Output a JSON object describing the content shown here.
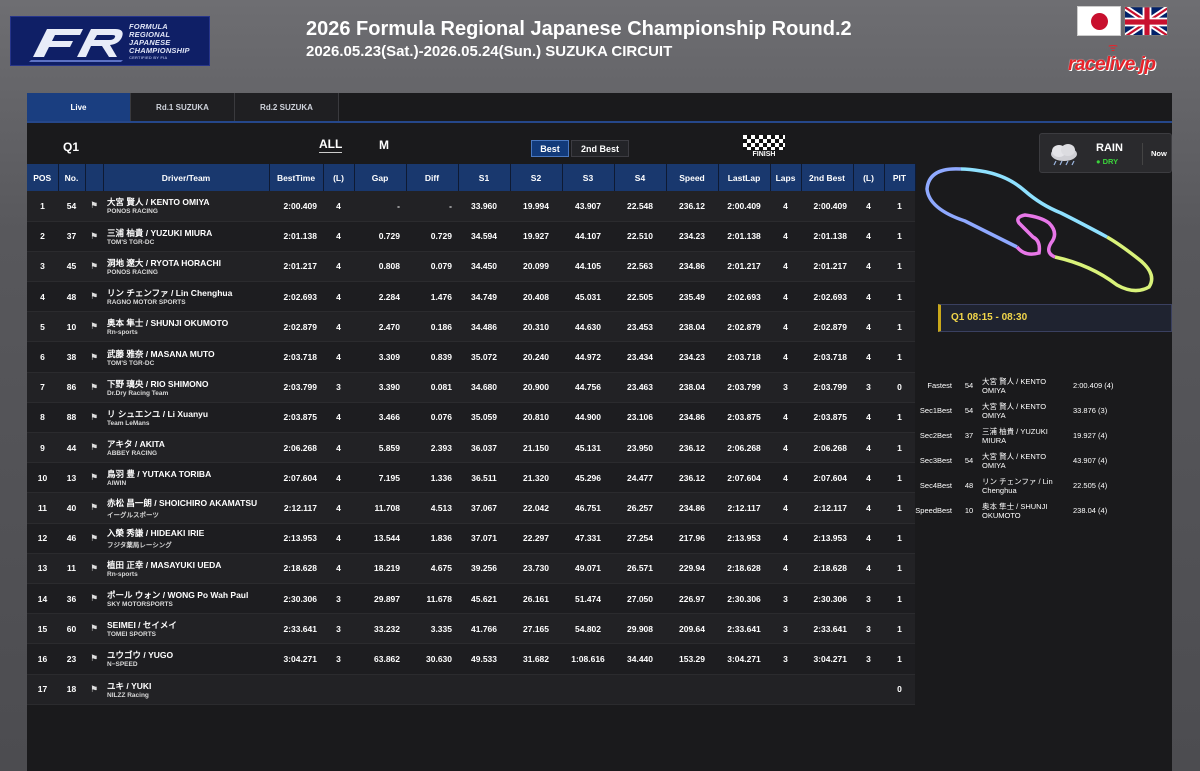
{
  "header": {
    "logo_text": [
      "FORMULA",
      "REGIONAL",
      "JAPANESE",
      "CHAMPIONSHIP"
    ],
    "logo_sub": "CERTIFIED BY FIA",
    "title": "2026 Formula Regional Japanese Championship Round.2",
    "subtitle": "2026.05.23(Sat.)-2026.05.24(Sun.) SUZUKA CIRCUIT",
    "brand": "racelive.jp"
  },
  "tabs": [
    "Live",
    "Rd.1 SUZUKA",
    "Rd.2 SUZUKA"
  ],
  "controls": {
    "session": "Q1",
    "all": "ALL",
    "m": "M",
    "best": "Best",
    "best2": "2nd Best",
    "finish": "FINISH"
  },
  "columns": [
    "POS",
    "No.",
    "",
    "Driver/Team",
    "BestTime",
    "(L)",
    "Gap",
    "Diff",
    "S1",
    "S2",
    "S3",
    "S4",
    "Speed",
    "LastLap",
    "Laps",
    "2nd Best",
    "(L)",
    "PIT"
  ],
  "rows": [
    {
      "pos": "1",
      "no": "54",
      "driver": "大宮 賢人 / KENTO OMIYA",
      "team": "PONOS RACING",
      "best": "2:00.409",
      "l": "4",
      "gap": "-",
      "diff": "-",
      "s1": "33.960",
      "s2": "19.994",
      "s3": "43.907",
      "s4": "22.548",
      "speed": "236.12",
      "last": "2:00.409",
      "laps": "4",
      "best2": "2:00.409",
      "l2": "4",
      "pit": "1",
      "c": [
        "w",
        "g",
        "r",
        "g",
        "g",
        "r"
      ]
    },
    {
      "pos": "2",
      "no": "37",
      "driver": "三浦 柚貴 / YUZUKI MIURA",
      "team": "TOM'S TGR-DC",
      "best": "2:01.138",
      "l": "4",
      "gap": "0.729",
      "diff": "0.729",
      "s1": "34.594",
      "s2": "19.927",
      "s3": "44.107",
      "s4": "22.510",
      "speed": "234.23",
      "last": "2:01.138",
      "laps": "4",
      "best2": "2:01.138",
      "l2": "4",
      "pit": "1",
      "c": [
        "g",
        "r",
        "g",
        "g",
        "g",
        "g"
      ]
    },
    {
      "pos": "3",
      "no": "45",
      "driver": "洞地 遼大 / RYOTA HORACHI",
      "team": "PONOS RACING",
      "best": "2:01.217",
      "l": "4",
      "gap": "0.808",
      "diff": "0.079",
      "s1": "34.450",
      "s2": "20.099",
      "s3": "44.105",
      "s4": "22.563",
      "speed": "234.86",
      "last": "2:01.217",
      "laps": "4",
      "best2": "2:01.217",
      "l2": "4",
      "pit": "1",
      "c": [
        "g",
        "g",
        "g",
        "g",
        "w",
        "g"
      ]
    },
    {
      "pos": "4",
      "no": "48",
      "driver": "リン チェンファ / Lin Chenghua",
      "team": "RAGNO MOTOR SPORTS",
      "best": "2:02.693",
      "l": "4",
      "gap": "2.284",
      "diff": "1.476",
      "s1": "34.749",
      "s2": "20.408",
      "s3": "45.031",
      "s4": "22.505",
      "speed": "235.49",
      "last": "2:02.693",
      "laps": "4",
      "best2": "2:02.693",
      "l2": "4",
      "pit": "1",
      "c": [
        "g",
        "g",
        "g",
        "r",
        "g",
        "g"
      ]
    },
    {
      "pos": "5",
      "no": "10",
      "driver": "奥本 隼士 / SHUNJI OKUMOTO",
      "team": "Rn-sports",
      "best": "2:02.879",
      "l": "4",
      "gap": "2.470",
      "diff": "0.186",
      "s1": "34.486",
      "s2": "20.310",
      "s3": "44.630",
      "s4": "23.453",
      "speed": "238.04",
      "last": "2:02.879",
      "laps": "4",
      "best2": "2:02.879",
      "l2": "4",
      "pit": "1",
      "c": [
        "w",
        "g",
        "g",
        "g",
        "r",
        "g"
      ]
    },
    {
      "pos": "6",
      "no": "38",
      "driver": "武藤 雅奈 / MASANA MUTO",
      "team": "TOM'S TGR-DC",
      "best": "2:03.718",
      "l": "4",
      "gap": "3.309",
      "diff": "0.839",
      "s1": "35.072",
      "s2": "20.240",
      "s3": "44.972",
      "s4": "23.434",
      "speed": "234.23",
      "last": "2:03.718",
      "laps": "4",
      "best2": "2:03.718",
      "l2": "4",
      "pit": "1",
      "c": [
        "g",
        "g",
        "g",
        "g",
        "g",
        "g"
      ]
    },
    {
      "pos": "7",
      "no": "86",
      "driver": "下野 璃央 / RIO SHIMONO",
      "team": "Dr.Dry Racing Team",
      "best": "2:03.799",
      "l": "3",
      "gap": "3.390",
      "diff": "0.081",
      "s1": "34.680",
      "s2": "20.900",
      "s3": "44.756",
      "s4": "23.463",
      "speed": "238.04",
      "last": "2:03.799",
      "laps": "3",
      "best2": "2:03.799",
      "l2": "3",
      "pit": "0",
      "c": [
        "g",
        "w",
        "g",
        "g",
        "g",
        "g"
      ]
    },
    {
      "pos": "8",
      "no": "88",
      "driver": "リ シュエンユ / Li Xuanyu",
      "team": "Team LeMans",
      "best": "2:03.875",
      "l": "4",
      "gap": "3.466",
      "diff": "0.076",
      "s1": "35.059",
      "s2": "20.810",
      "s3": "44.900",
      "s4": "23.106",
      "speed": "234.86",
      "last": "2:03.875",
      "laps": "4",
      "best2": "2:03.875",
      "l2": "4",
      "pit": "1",
      "c": [
        "g",
        "g",
        "g",
        "g",
        "g",
        "g"
      ]
    },
    {
      "pos": "9",
      "no": "44",
      "driver": "アキタ / AKITA",
      "team": "ABBEY RACING",
      "best": "2:06.268",
      "l": "4",
      "gap": "5.859",
      "diff": "2.393",
      "s1": "36.037",
      "s2": "21.150",
      "s3": "45.131",
      "s4": "23.950",
      "speed": "236.12",
      "last": "2:06.268",
      "laps": "4",
      "best2": "2:06.268",
      "l2": "4",
      "pit": "1",
      "c": [
        "g",
        "g",
        "g",
        "g",
        "g",
        "g"
      ]
    },
    {
      "pos": "10",
      "no": "13",
      "driver": "鳥羽 豊 / YUTAKA TORIBA",
      "team": "AIWIN",
      "best": "2:07.604",
      "l": "4",
      "gap": "7.195",
      "diff": "1.336",
      "s1": "36.511",
      "s2": "21.320",
      "s3": "45.296",
      "s4": "24.477",
      "speed": "236.12",
      "last": "2:07.604",
      "laps": "4",
      "best2": "2:07.604",
      "l2": "4",
      "pit": "1",
      "c": [
        "w",
        "w",
        "g",
        "w",
        "g",
        "g"
      ]
    },
    {
      "pos": "11",
      "no": "40",
      "driver": "赤松 昌一朗 / SHOICHIRO AKAMATSU",
      "team": "イーグルスポーツ",
      "best": "2:12.117",
      "l": "4",
      "gap": "11.708",
      "diff": "4.513",
      "s1": "37.067",
      "s2": "22.042",
      "s3": "46.751",
      "s4": "26.257",
      "speed": "234.86",
      "last": "2:12.117",
      "laps": "4",
      "best2": "2:12.117",
      "l2": "4",
      "pit": "1",
      "c": [
        "g",
        "g",
        "g",
        "w",
        "w",
        "g"
      ]
    },
    {
      "pos": "12",
      "no": "46",
      "driver": "入榮 秀謙 / HIDEAKI IRIE",
      "team": "フジタ薬局レーシング",
      "best": "2:13.953",
      "l": "4",
      "gap": "13.544",
      "diff": "1.836",
      "s1": "37.071",
      "s2": "22.297",
      "s3": "47.331",
      "s4": "27.254",
      "speed": "217.96",
      "last": "2:13.953",
      "laps": "4",
      "best2": "2:13.953",
      "l2": "4",
      "pit": "1",
      "c": [
        "g",
        "g",
        "w",
        "w",
        "w",
        "g"
      ]
    },
    {
      "pos": "13",
      "no": "11",
      "driver": "植田 正幸 / MASAYUKI UEDA",
      "team": "Rn-sports",
      "best": "2:18.628",
      "l": "4",
      "gap": "18.219",
      "diff": "4.675",
      "s1": "39.256",
      "s2": "23.730",
      "s3": "49.071",
      "s4": "26.571",
      "speed": "229.94",
      "last": "2:18.628",
      "laps": "4",
      "best2": "2:18.628",
      "l2": "4",
      "pit": "1",
      "c": [
        "g",
        "g",
        "g",
        "g",
        "g",
        "g"
      ]
    },
    {
      "pos": "14",
      "no": "36",
      "driver": "ポール ウォン / WONG Po Wah Paul",
      "team": "SKY MOTORSPORTS",
      "best": "2:30.306",
      "l": "3",
      "gap": "29.897",
      "diff": "11.678",
      "s1": "45.621",
      "s2": "26.161",
      "s3": "51.474",
      "s4": "27.050",
      "speed": "226.97",
      "last": "2:30.306",
      "laps": "3",
      "best2": "2:30.306",
      "l2": "3",
      "pit": "1",
      "c": [
        "g",
        "g",
        "g",
        "g",
        "g",
        "g"
      ]
    },
    {
      "pos": "15",
      "no": "60",
      "driver": "SEIMEI / セイメイ",
      "team": "TOMEI SPORTS",
      "best": "2:33.641",
      "l": "3",
      "gap": "33.232",
      "diff": "3.335",
      "s1": "41.766",
      "s2": "27.165",
      "s3": "54.802",
      "s4": "29.908",
      "speed": "209.64",
      "last": "2:33.641",
      "laps": "3",
      "best2": "2:33.641",
      "l2": "3",
      "pit": "1",
      "c": [
        "g",
        "g",
        "g",
        "g",
        "w",
        "g"
      ]
    },
    {
      "pos": "16",
      "no": "23",
      "driver": "ユウゴウ / YUGO",
      "team": "N−SPEED",
      "best": "3:04.271",
      "l": "3",
      "gap": "63.862",
      "diff": "30.630",
      "s1": "49.533",
      "s2": "31.682",
      "s3": "1:08.616",
      "s4": "34.440",
      "speed": "153.29",
      "last": "3:04.271",
      "laps": "3",
      "best2": "3:04.271",
      "l2": "3",
      "pit": "1",
      "c": [
        "g",
        "w",
        "g",
        "g",
        "w",
        "g"
      ]
    },
    {
      "pos": "17",
      "no": "18",
      "driver": "ユキ / YUKI",
      "team": "NILZZ Racing",
      "best": "",
      "l": "",
      "gap": "",
      "diff": "",
      "s1": "",
      "s2": "",
      "s3": "",
      "s4": "",
      "speed": "",
      "last": "",
      "laps": "",
      "best2": "",
      "l2": "",
      "pit": "0",
      "c": [
        "w",
        "w",
        "w",
        "w",
        "w",
        "w"
      ]
    }
  ],
  "weather": {
    "condition": "RAIN",
    "track": "● DRY",
    "now": "Now"
  },
  "session_bar": "Q1 08:15 - 08:30",
  "bests": [
    {
      "label": "Fastest",
      "no": "54",
      "driver": "大宮 賢人 / KENTO OMIYA",
      "value": "2:00.409 (4)"
    },
    {
      "label": "Sec1Best",
      "no": "54",
      "driver": "大宮 賢人 / KENTO OMIYA",
      "value": "33.876 (3)"
    },
    {
      "label": "Sec2Best",
      "no": "37",
      "driver": "三浦 柚貴 / YUZUKI MIURA",
      "value": "19.927 (4)"
    },
    {
      "label": "Sec3Best",
      "no": "54",
      "driver": "大宮 賢人 / KENTO OMIYA",
      "value": "43.907 (4)"
    },
    {
      "label": "Sec4Best",
      "no": "48",
      "driver": "リン チェンファ / Lin Chenghua",
      "value": "22.505 (4)"
    },
    {
      "label": "SpeedBest",
      "no": "10",
      "driver": "奥本 隼士 / SHUNJI OKUMOTO",
      "value": "238.04 (4)"
    }
  ],
  "colors": {
    "green": "#3bd33b",
    "red": "#e03a3a",
    "header_blue": "#19386e",
    "active_tab": "#1a3e80",
    "session_gold": "#f2d64a"
  }
}
